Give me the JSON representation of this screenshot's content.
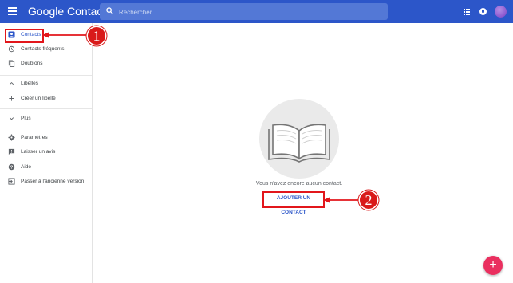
{
  "header": {
    "app_title": "Google Contacts",
    "search_placeholder": "Rechercher"
  },
  "sidebar": {
    "items": [
      {
        "label": "Contacts",
        "icon": "person-icon",
        "selected": true
      },
      {
        "label": "Contacts fréquents",
        "icon": "history-icon"
      },
      {
        "label": "Doublons",
        "icon": "copy-icon"
      },
      {
        "label": "Libellés",
        "icon": "chevron-up-icon"
      },
      {
        "label": "Créer un libellé",
        "icon": "plus-icon"
      },
      {
        "label": "Plus",
        "icon": "chevron-down-icon"
      },
      {
        "label": "Paramètres",
        "icon": "gear-icon"
      },
      {
        "label": "Laisser un avis",
        "icon": "feedback-icon"
      },
      {
        "label": "Aide",
        "icon": "help-icon"
      },
      {
        "label": "Passer à l'ancienne version",
        "icon": "exit-icon"
      }
    ]
  },
  "main": {
    "empty_message": "Vous n'avez encore aucun contact.",
    "add_contact_label": "AJOUTER UN CONTACT"
  },
  "annotations": {
    "callout_1": "1",
    "callout_2": "2",
    "callout_color": "#e2161b"
  },
  "fab": {
    "label": "+"
  },
  "colors": {
    "topbar": "#2c56c9",
    "fab": "#ea2f5f",
    "link": "#2c56c9"
  }
}
